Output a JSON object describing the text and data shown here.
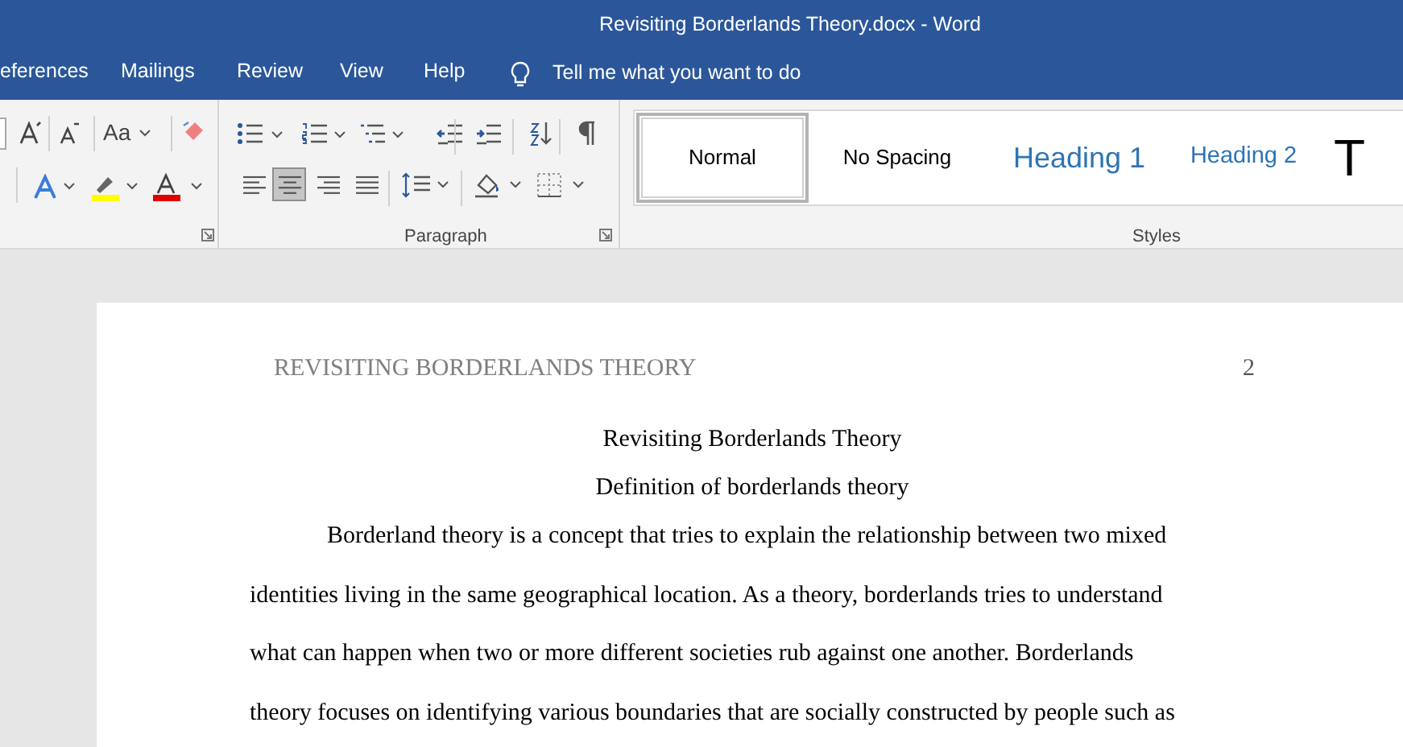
{
  "window": {
    "title": "Revisiting Borderlands Theory.docx - Word"
  },
  "menu_tabs": [
    {
      "label": "eferences"
    },
    {
      "label": "Mailings"
    },
    {
      "label": "Review"
    },
    {
      "label": "View"
    },
    {
      "label": "Help"
    }
  ],
  "tell_me": {
    "placeholder": "Tell me what you want to do"
  },
  "font_group": {
    "change_case": "Aa"
  },
  "paragraph_group": {
    "label": "Paragraph",
    "alignment_buttons": [
      {
        "kind": "left",
        "selected": false
      },
      {
        "kind": "center",
        "selected": true
      },
      {
        "kind": "right",
        "selected": false
      },
      {
        "kind": "justify",
        "selected": false
      }
    ]
  },
  "styles_group": {
    "label": "Styles",
    "items": [
      {
        "label": "Normal",
        "kind": "normal",
        "selected": true
      },
      {
        "label": "No Spacing",
        "kind": "normal",
        "selected": false
      },
      {
        "label": "Heading 1",
        "kind": "heading1",
        "selected": false
      },
      {
        "label": "Heading 2",
        "kind": "heading2",
        "selected": false
      },
      {
        "label": "T",
        "kind": "title",
        "selected": false
      }
    ]
  },
  "document": {
    "header": "REVISITING BORDERLANDS THEORY",
    "page_number": "2",
    "title": "Revisiting Borderlands Theory",
    "subtitle": "Definition of borderlands theory",
    "paragraph_lines": [
      "Borderland theory is a concept that tries to explain the relationship between two mixed",
      "identities living in the same geographical location. As a theory, borderlands tries to understand",
      "what can happen when two or more different societies rub against one another. Borderlands",
      "theory focuses on identifying various boundaries that are socially constructed by people such as"
    ]
  }
}
